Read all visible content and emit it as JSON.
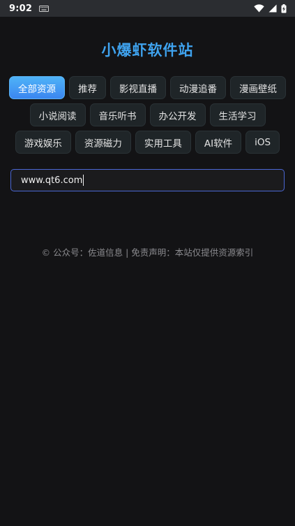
{
  "status_bar": {
    "time": "9:02",
    "icons": [
      "keyboard-icon",
      "wifi-icon",
      "cellular-icon",
      "battery-charging-icon"
    ]
  },
  "site": {
    "title": "小爆虾软件站"
  },
  "categories": [
    {
      "label": "全部资源",
      "active": true
    },
    {
      "label": "推荐",
      "active": false
    },
    {
      "label": "影视直播",
      "active": false
    },
    {
      "label": "动漫追番",
      "active": false
    },
    {
      "label": "漫画壁纸",
      "active": false
    },
    {
      "label": "小说阅读",
      "active": false
    },
    {
      "label": "音乐听书",
      "active": false
    },
    {
      "label": "办公开发",
      "active": false
    },
    {
      "label": "生活学习",
      "active": false
    },
    {
      "label": "游戏娱乐",
      "active": false
    },
    {
      "label": "资源磁力",
      "active": false
    },
    {
      "label": "实用工具",
      "active": false
    },
    {
      "label": "AI软件",
      "active": false
    },
    {
      "label": "iOS",
      "active": false
    }
  ],
  "search": {
    "value": "www.qt6.com"
  },
  "footer": {
    "text": "© 公众号：佐道信息 | 免责声明：本站仅提供资源索引"
  },
  "colors": {
    "accent": "#3fa3ef",
    "input_border": "#4b67d4",
    "background": "#131315"
  }
}
